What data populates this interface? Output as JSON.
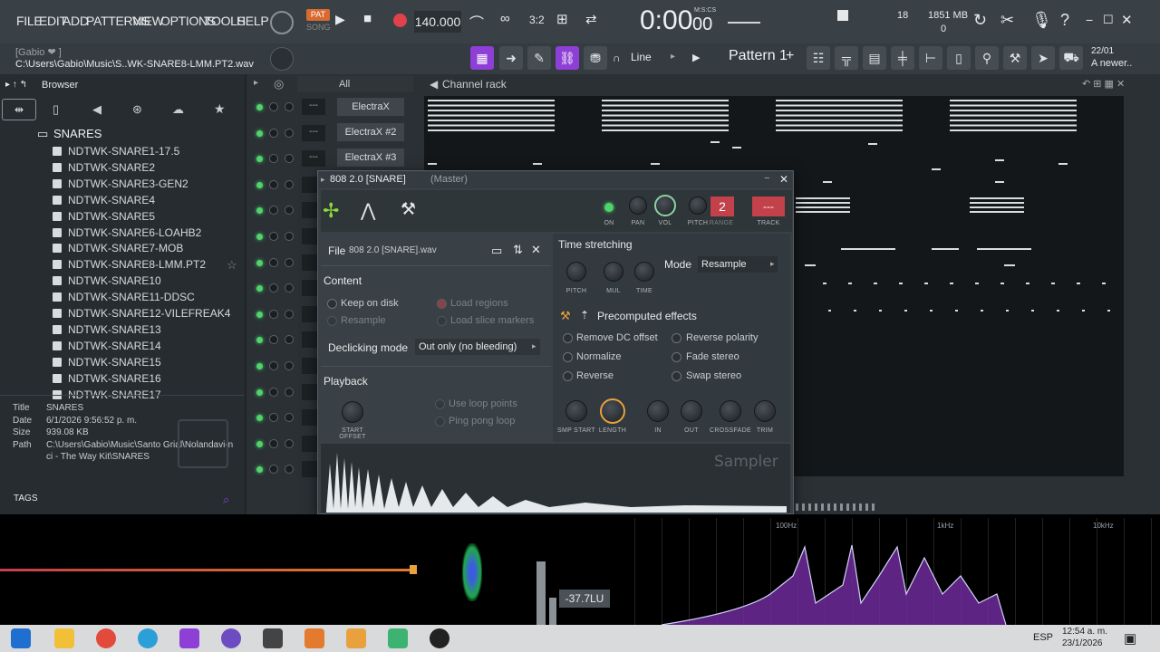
{
  "menu": [
    "FILE",
    "EDIT",
    "ADD",
    "PATTERNS",
    "VIEW",
    "OPTIONS",
    "TOOLS",
    "HELP"
  ],
  "transport": {
    "pat": "PAT",
    "song": "SONG",
    "tempo": "140.000",
    "time": "0:00",
    "time_sub": "00",
    "time_unit": "M:S:CS",
    "cpu": "18",
    "mem": "1851 MB",
    "mem2": "0"
  },
  "hint": {
    "user": "[Gabio ❤ ]",
    "path": "C:\\Users\\Gabio\\Music\\S..WK-SNARE8-LMM.PT2.wav"
  },
  "toolbar": {
    "snap": "Line",
    "pattern": "Pattern 1",
    "news_date": "22/01",
    "news_text": "A newer.."
  },
  "browser": {
    "title": "Browser",
    "folder": "SNARES",
    "files": [
      "NDTWK-SNARE1-17.5",
      "NDTWK-SNARE2",
      "NDTWK-SNARE3-GEN2",
      "NDTWK-SNARE4",
      "NDTWK-SNARE5",
      "NDTWK-SNARE6-LOAHB2",
      "NDTWK-SNARE7-MOB",
      "NDTWK-SNARE8-LMM.PT2",
      "NDTWK-SNARE10",
      "NDTWK-SNARE11-DDSC",
      "NDTWK-SNARE12-VILEFREAK4",
      "NDTWK-SNARE13",
      "NDTWK-SNARE14",
      "NDTWK-SNARE15",
      "NDTWK-SNARE16",
      "NDTWK-SNARE17"
    ],
    "info": {
      "title_label": "Title",
      "title": "SNARES",
      "date_label": "Date",
      "date": "6/1/2026 9:56:52 p. m.",
      "size_label": "Size",
      "size": "939.08 KB",
      "path_label": "Path",
      "path": "C:\\Users\\Gabio\\Music\\Santo Grial\\Nolandavi-nci - The Way Kit\\SNARES"
    },
    "tags": "TAGS"
  },
  "channel_rack": {
    "filter": "All",
    "title": "Channel rack",
    "channels": [
      "ElectraX",
      "ElectraX #2",
      "ElectraX #3"
    ],
    "empty_label": "---"
  },
  "sampler": {
    "title": "808 2.0 [SNARE]",
    "title_suffix": "(Master)",
    "file_label": "File",
    "file": "808 2.0 [SNARE].wav",
    "top_knobs": [
      "ON",
      "PAN",
      "VOL",
      "PITCH",
      "RANGE",
      "TRACK"
    ],
    "range_value": "2",
    "track_value": "---",
    "content": "Content",
    "keep_on_disk": "Keep on disk",
    "resample": "Resample",
    "load_regions": "Load regions",
    "load_slice": "Load slice markers",
    "declicking_label": "Declicking mode",
    "declicking": "Out only (no bleeding)",
    "playback": "Playback",
    "start_offset": "START OFFSET",
    "use_loop": "Use loop points",
    "ping_pong": "Ping pong loop",
    "time_stretching": "Time stretching",
    "ts_knobs": [
      "PITCH",
      "MUL",
      "TIME"
    ],
    "mode_label": "Mode",
    "mode": "Resample",
    "precomputed": "Precomputed effects",
    "fx": [
      "Remove DC offset",
      "Normalize",
      "Reverse",
      "Reverse polarity",
      "Fade stereo",
      "Swap stereo"
    ],
    "bottom_knobs": [
      "SMP START",
      "LENGTH",
      "IN",
      "OUT",
      "CROSSFADE",
      "TRIM"
    ],
    "brand": "Sampler"
  },
  "analyzer": {
    "lufs": "-37.7LU",
    "f1": "100Hz",
    "f2": "1kHz",
    "f3": "10kHz"
  },
  "taskbar": {
    "lang": "ESP",
    "time": "12:54 a. m.",
    "date": "23/1/2026"
  }
}
